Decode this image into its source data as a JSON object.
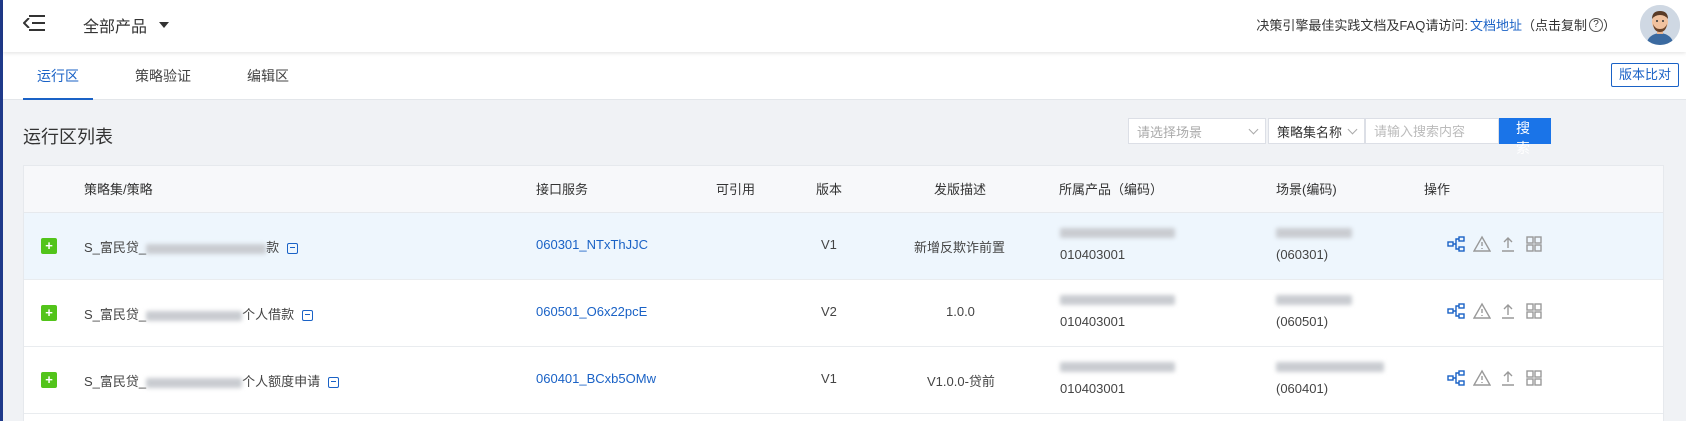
{
  "header": {
    "product_select": "全部产品",
    "info_text": "决策引擎最佳实践文档及FAQ请访问:",
    "doc_link": "文档地址",
    "copy_hint_open": "（点击复制",
    "copy_hint_close": "）",
    "help_glyph": "?"
  },
  "tabs": [
    {
      "label": "运行区",
      "active": true
    },
    {
      "label": "策略验证",
      "active": false
    },
    {
      "label": "编辑区",
      "active": false
    }
  ],
  "compare_button": "版本比对",
  "list_title": "运行区列表",
  "filters": {
    "scene_placeholder": "请选择场景",
    "field_select": "策略集名称",
    "search_placeholder": "请输入搜索内容",
    "search_button": "搜 索"
  },
  "table": {
    "columns": [
      "策略集/策略",
      "接口服务",
      "可引用",
      "版本",
      "发版描述",
      "所属产品（编码）",
      "场景(编码)",
      "操作"
    ],
    "rows": [
      {
        "expand": "+",
        "name_prefix": "S_富民贷_",
        "name_suffix": "款",
        "service": "060301_NTxThJJC",
        "referable": "",
        "version": "V1",
        "release_desc": "新增反欺诈前置",
        "product_code": "010403001",
        "scene_code": "(060301)",
        "highlighted": true
      },
      {
        "expand": "+",
        "name_prefix": "S_富民贷_",
        "name_suffix": "个人借款",
        "service": "060501_O6x22pcE",
        "referable": "",
        "version": "V2",
        "release_desc": "1.0.0",
        "product_code": "010403001",
        "scene_code": "(060501)",
        "highlighted": false
      },
      {
        "expand": "+",
        "name_prefix": "S_富民贷_",
        "name_suffix": "个人额度申请",
        "service": "060401_BCxb5OMw",
        "referable": "",
        "version": "V1",
        "release_desc": "V1.0.0-贷前",
        "product_code": "010403001",
        "scene_code": "(060401)",
        "highlighted": false
      }
    ],
    "row_actions": [
      "flow-icon",
      "warning-icon",
      "upload-icon",
      "grid-icon"
    ]
  },
  "colors": {
    "accent": "#1a62c6",
    "search_button": "#1a74e8",
    "expand_button": "#52c41a",
    "highlight_row": "#eef6fd"
  }
}
